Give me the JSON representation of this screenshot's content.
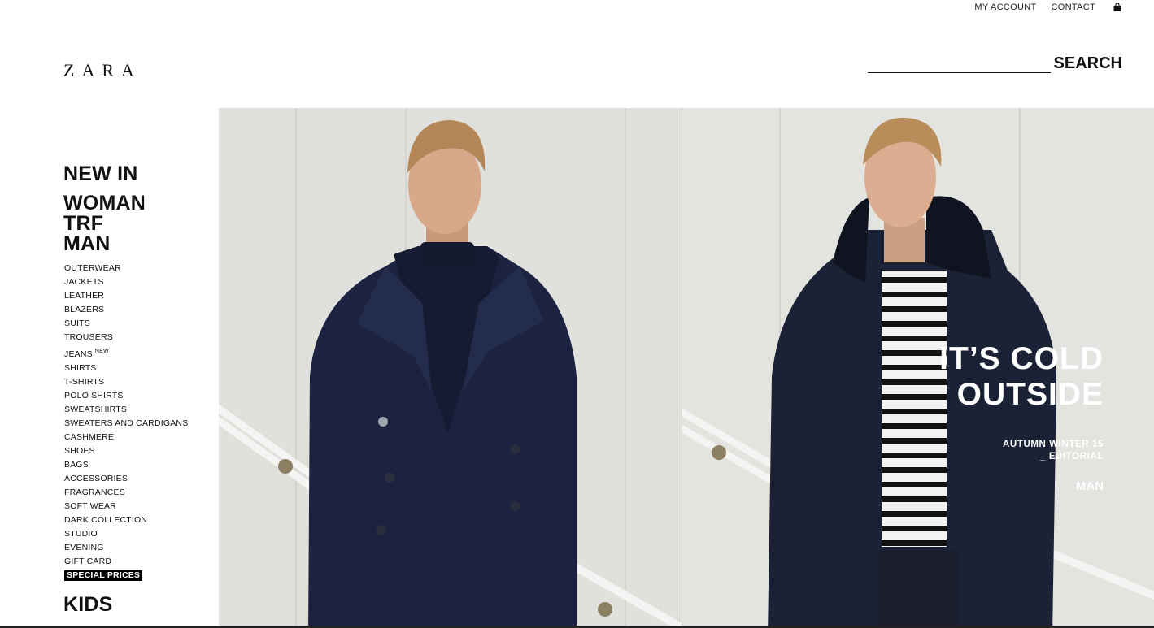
{
  "header": {
    "my_account": "MY ACCOUNT",
    "contact": "CONTACT",
    "logo": "ZARA",
    "search_label": "SEARCH",
    "search_value": ""
  },
  "nav": {
    "new_in": "NEW IN",
    "woman": "WOMAN",
    "trf": "TRF",
    "man": "MAN",
    "man_items": [
      "OUTERWEAR",
      "JACKETS",
      "LEATHER",
      "BLAZERS",
      "SUITS",
      "TROUSERS",
      "JEANS",
      "SHIRTS",
      "T-SHIRTS",
      "POLO SHIRTS",
      "SWEATSHIRTS",
      "SWEATERS AND CARDIGANS",
      "CASHMERE",
      "SHOES",
      "BAGS",
      "ACCESSORIES",
      "FRAGRANCES",
      "SOFT WEAR",
      "DARK COLLECTION",
      "STUDIO",
      "EVENING",
      "GIFT CARD"
    ],
    "jeans_badge": "NEW",
    "special_prices": "SPECIAL PRICES",
    "kids": "KIDS"
  },
  "hero": {
    "headline_line1": "IT’S COLD",
    "headline_line2": "OUTSIDE",
    "season_line1": "AUTUMN WINTER 15",
    "season_line2": "_ EDITORIAL",
    "section": "MAN"
  },
  "icons": {
    "bag": "shopping-bag-icon"
  },
  "colors": {
    "coat": "#1c2340",
    "wall": "#e2e2df",
    "hair": "#b8895a",
    "skin": "#d9a98a"
  }
}
